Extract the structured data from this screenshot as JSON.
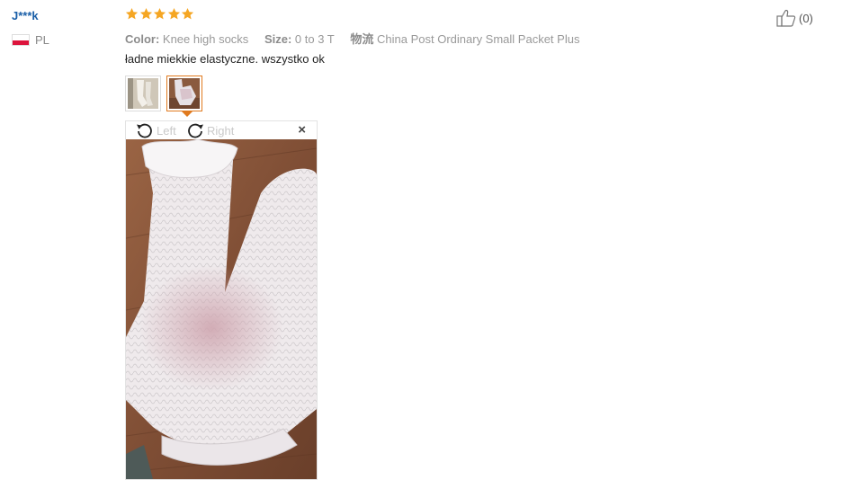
{
  "reviewer": {
    "name": "J***k",
    "country": "PL"
  },
  "rating": {
    "stars": 5,
    "max": 5,
    "star_color": "#f5a623"
  },
  "attributes": {
    "color_label": "Color:",
    "color_value": "Knee high socks",
    "size_label": "Size:",
    "size_value": "0 to 3 T",
    "shipping_label": "物流",
    "shipping_value": "China Post Ordinary Small Packet Plus"
  },
  "review_text": "ładne miekkie elastyczne. wszystko ok",
  "helpful": {
    "count_text": "(0)",
    "icon": "thumbs-up-icon"
  },
  "thumbnails": [
    {
      "name": "thumbnail-1",
      "active": false
    },
    {
      "name": "thumbnail-2",
      "active": true
    }
  ],
  "viewer": {
    "rotate_left_label": "Left",
    "rotate_right_label": "Right",
    "close_symbol": "×"
  },
  "colors": {
    "accent": "#e07a1f",
    "link": "#1a5fa8"
  }
}
